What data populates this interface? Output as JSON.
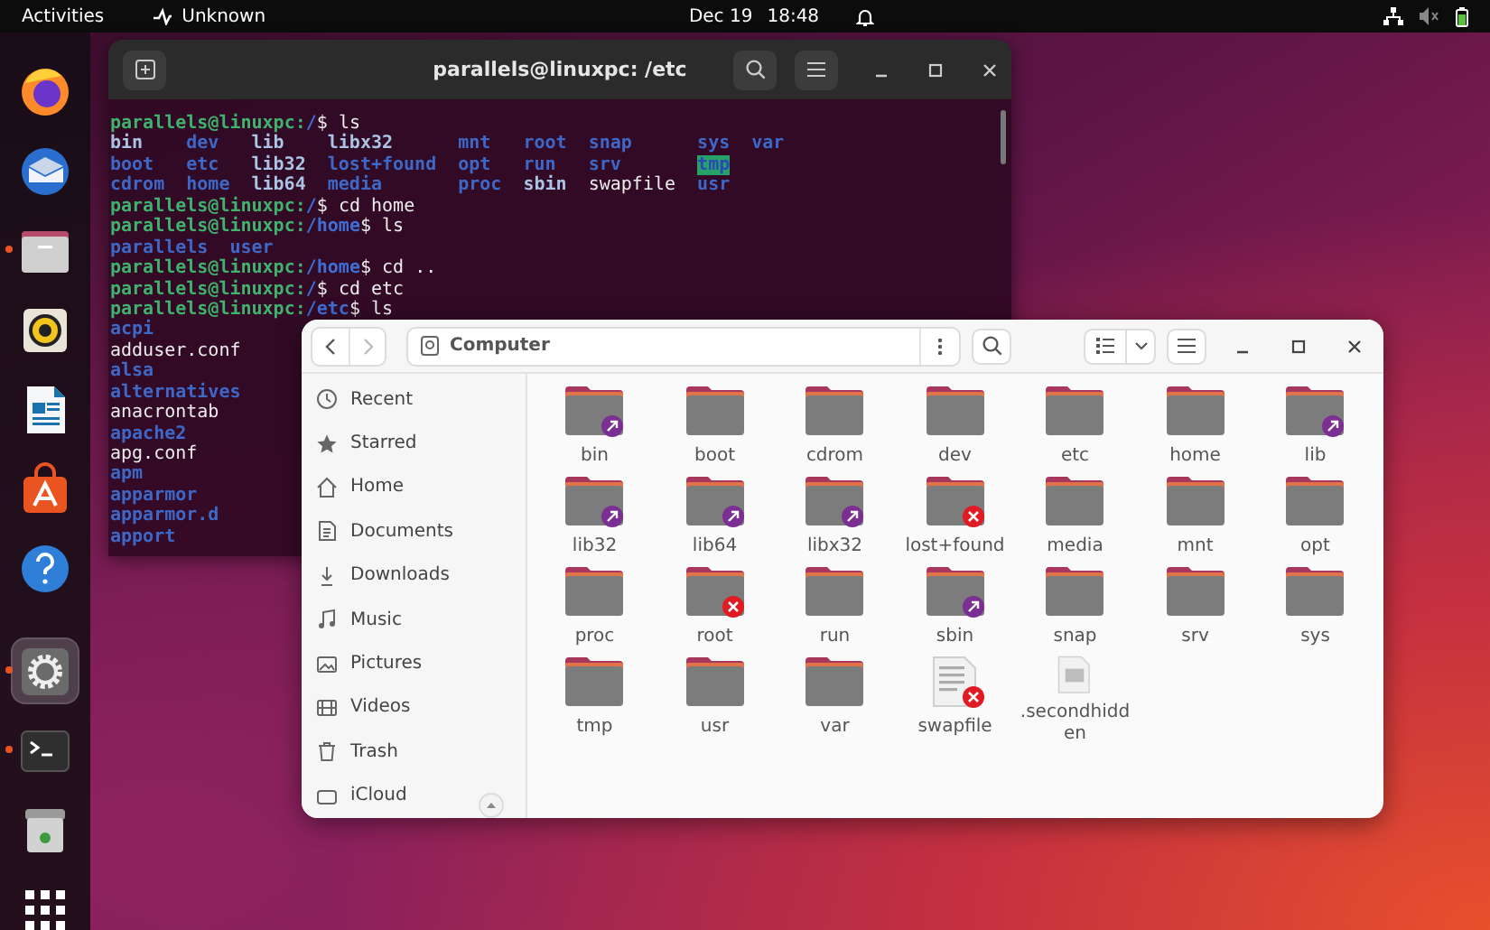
{
  "top_bar": {
    "activities": "Activities",
    "indicator": "Unknown",
    "date": "Dec 19",
    "time": "18:48"
  },
  "dock": [
    {
      "kind": "browser",
      "running": false,
      "active": false
    },
    {
      "kind": "mail",
      "running": false,
      "active": false
    },
    {
      "kind": "files",
      "running": true,
      "active": false
    },
    {
      "kind": "music",
      "running": false,
      "active": false
    },
    {
      "kind": "writer",
      "running": false,
      "active": false
    },
    {
      "kind": "store",
      "running": false,
      "active": false
    },
    {
      "kind": "help",
      "running": false,
      "active": false
    },
    {
      "kind": "separator"
    },
    {
      "kind": "settings",
      "running": true,
      "active": true
    },
    {
      "kind": "terminal",
      "running": true,
      "active": false
    },
    {
      "kind": "trash",
      "running": false,
      "active": false
    },
    {
      "kind": "apps",
      "running": false,
      "active": false
    }
  ],
  "terminal": {
    "title": "parallels@linuxpc: /etc",
    "lines": [
      {
        "kind": "prompt",
        "user": "parallels@linuxpc:",
        "path": "/",
        "input": "$ ls"
      },
      {
        "kind": "ls",
        "cells": [
          {
            "text": "bin",
            "kind": "link"
          },
          {
            "text": "dev",
            "kind": "dir"
          },
          {
            "text": "lib",
            "kind": "link"
          },
          {
            "text": "libx32",
            "kind": "link"
          },
          {
            "text": "mnt",
            "kind": "dir"
          },
          {
            "text": "root",
            "kind": "dir"
          },
          {
            "text": "snap",
            "kind": "dir"
          },
          {
            "text": "sys",
            "kind": "dir"
          },
          {
            "text": "var",
            "kind": "dir"
          }
        ]
      },
      {
        "kind": "ls",
        "cells": [
          {
            "text": "boot",
            "kind": "dir"
          },
          {
            "text": "etc",
            "kind": "dir"
          },
          {
            "text": "lib32",
            "kind": "link"
          },
          {
            "text": "lost+found",
            "kind": "dir"
          },
          {
            "text": "opt",
            "kind": "dir"
          },
          {
            "text": "run",
            "kind": "dir"
          },
          {
            "text": "srv",
            "kind": "dir"
          },
          {
            "text": "tmp",
            "kind": "sticky"
          }
        ]
      },
      {
        "kind": "ls",
        "cells": [
          {
            "text": "cdrom",
            "kind": "dir"
          },
          {
            "text": "home",
            "kind": "dir"
          },
          {
            "text": "lib64",
            "kind": "link"
          },
          {
            "text": "media",
            "kind": "dir"
          },
          {
            "text": "proc",
            "kind": "dir"
          },
          {
            "text": "sbin",
            "kind": "link"
          },
          {
            "text": "swapfile",
            "kind": "file"
          },
          {
            "text": "usr",
            "kind": "dir"
          }
        ]
      },
      {
        "kind": "prompt",
        "user": "parallels@linuxpc:",
        "path": "/",
        "input": "$ cd home"
      },
      {
        "kind": "prompt",
        "user": "parallels@linuxpc:",
        "path": "/home",
        "input": "$ ls"
      },
      {
        "kind": "ls",
        "cells": [
          {
            "text": "parallels",
            "kind": "dir"
          },
          {
            "text": "user",
            "kind": "dir"
          }
        ]
      },
      {
        "kind": "prompt",
        "user": "parallels@linuxpc:",
        "path": "/home",
        "input": "$ cd .."
      },
      {
        "kind": "prompt",
        "user": "parallels@linuxpc:",
        "path": "/",
        "input": "$ cd etc"
      },
      {
        "kind": "prompt",
        "user": "parallels@linuxpc:",
        "path": "/etc",
        "input": "$ ls"
      },
      {
        "kind": "ls",
        "cells": [
          {
            "text": "acpi",
            "kind": "dir"
          }
        ]
      },
      {
        "kind": "ls",
        "cells": [
          {
            "text": "adduser.conf",
            "kind": "file"
          }
        ]
      },
      {
        "kind": "ls",
        "cells": [
          {
            "text": "alsa",
            "kind": "dir"
          }
        ]
      },
      {
        "kind": "ls",
        "cells": [
          {
            "text": "alternatives",
            "kind": "dir"
          }
        ]
      },
      {
        "kind": "ls",
        "cells": [
          {
            "text": "anacrontab",
            "kind": "file"
          }
        ]
      },
      {
        "kind": "ls",
        "cells": [
          {
            "text": "apache2",
            "kind": "dir"
          }
        ]
      },
      {
        "kind": "ls",
        "cells": [
          {
            "text": "apg.conf",
            "kind": "file"
          }
        ]
      },
      {
        "kind": "ls",
        "cells": [
          {
            "text": "apm",
            "kind": "dir"
          }
        ]
      },
      {
        "kind": "ls",
        "cells": [
          {
            "text": "apparmor",
            "kind": "dir"
          }
        ]
      },
      {
        "kind": "ls",
        "cells": [
          {
            "text": "apparmor.d",
            "kind": "dir"
          }
        ]
      },
      {
        "kind": "ls",
        "cells": [
          {
            "text": "apport",
            "kind": "dir"
          }
        ]
      }
    ]
  },
  "files": {
    "location": "Computer",
    "sidebar": [
      {
        "label": "Recent",
        "kind": "recent",
        "selected": false
      },
      {
        "label": "Starred",
        "kind": "starred",
        "selected": false
      },
      {
        "label": "Home",
        "kind": "home",
        "selected": false
      },
      {
        "label": "Documents",
        "kind": "documents",
        "selected": false
      },
      {
        "label": "Downloads",
        "kind": "downloads",
        "selected": false
      },
      {
        "label": "Music",
        "kind": "music",
        "selected": false
      },
      {
        "label": "Pictures",
        "kind": "pictures",
        "selected": false
      },
      {
        "label": "Videos",
        "kind": "videos",
        "selected": false
      },
      {
        "label": "Trash",
        "kind": "trash",
        "selected": false
      },
      {
        "label": "iCloud",
        "kind": "cloud",
        "selected": false
      }
    ],
    "items": [
      {
        "name": "bin",
        "kind": "folder",
        "symlink": true,
        "locked": false
      },
      {
        "name": "boot",
        "kind": "folder",
        "symlink": false,
        "locked": false
      },
      {
        "name": "cdrom",
        "kind": "folder",
        "symlink": false,
        "locked": false
      },
      {
        "name": "dev",
        "kind": "folder",
        "symlink": false,
        "locked": false
      },
      {
        "name": "etc",
        "kind": "folder",
        "symlink": false,
        "locked": false
      },
      {
        "name": "home",
        "kind": "folder",
        "symlink": false,
        "locked": false
      },
      {
        "name": "lib",
        "kind": "folder",
        "symlink": true,
        "locked": false
      },
      {
        "name": "lib32",
        "kind": "folder",
        "symlink": true,
        "locked": false
      },
      {
        "name": "lib64",
        "kind": "folder",
        "symlink": true,
        "locked": false
      },
      {
        "name": "libx32",
        "kind": "folder",
        "symlink": true,
        "locked": false
      },
      {
        "name": "lost+found",
        "kind": "folder",
        "symlink": false,
        "locked": true
      },
      {
        "name": "media",
        "kind": "folder",
        "symlink": false,
        "locked": false
      },
      {
        "name": "mnt",
        "kind": "folder",
        "symlink": false,
        "locked": false
      },
      {
        "name": "opt",
        "kind": "folder",
        "symlink": false,
        "locked": false
      },
      {
        "name": "proc",
        "kind": "folder",
        "symlink": false,
        "locked": false
      },
      {
        "name": "root",
        "kind": "folder",
        "symlink": false,
        "locked": true
      },
      {
        "name": "run",
        "kind": "folder",
        "symlink": false,
        "locked": false
      },
      {
        "name": "sbin",
        "kind": "folder",
        "symlink": true,
        "locked": false
      },
      {
        "name": "snap",
        "kind": "folder",
        "symlink": false,
        "locked": false
      },
      {
        "name": "srv",
        "kind": "folder",
        "symlink": false,
        "locked": false
      },
      {
        "name": "sys",
        "kind": "folder",
        "symlink": false,
        "locked": false
      },
      {
        "name": "tmp",
        "kind": "folder",
        "symlink": false,
        "locked": false
      },
      {
        "name": "usr",
        "kind": "folder",
        "symlink": false,
        "locked": false
      },
      {
        "name": "var",
        "kind": "folder",
        "symlink": false,
        "locked": false
      },
      {
        "name": "swapfile",
        "kind": "binary",
        "symlink": false,
        "locked": true
      },
      {
        "name": ".secondhidden",
        "kind": "document",
        "symlink": false,
        "locked": false
      }
    ]
  }
}
